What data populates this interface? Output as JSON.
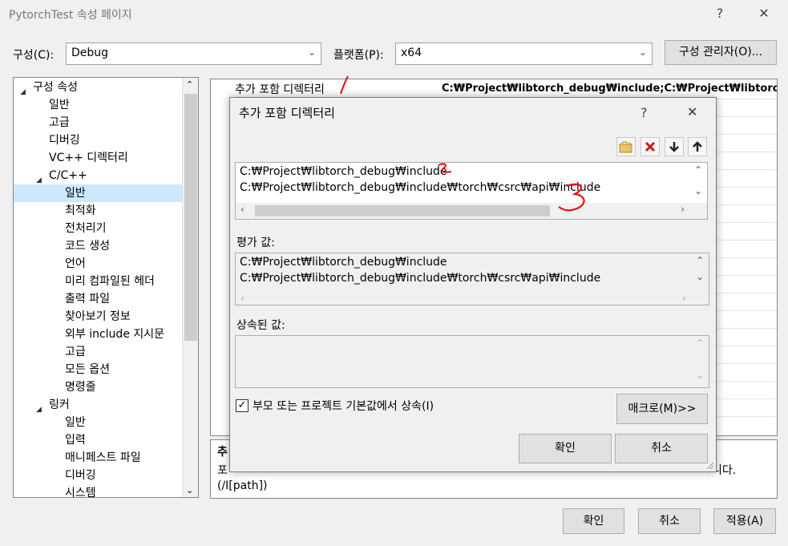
{
  "window": {
    "title": "PytorchTest 속성 페이지",
    "help": "?",
    "close": "✕"
  },
  "config": {
    "label": "구성(C):",
    "value": "Debug"
  },
  "platform": {
    "label": "플랫폼(P):",
    "value": "x64"
  },
  "config_manager_button": "구성 관리자(O)...",
  "tree": {
    "items": [
      {
        "label": "구성 속성",
        "level": 0,
        "expander": "◢"
      },
      {
        "label": "일반",
        "level": 1
      },
      {
        "label": "고급",
        "level": 1
      },
      {
        "label": "디버깅",
        "level": 1
      },
      {
        "label": "VC++ 디렉터리",
        "level": 1
      },
      {
        "label": "C/C++",
        "level": 1,
        "expander": "◢"
      },
      {
        "label": "일반",
        "level": 2,
        "selected": true
      },
      {
        "label": "최적화",
        "level": 2
      },
      {
        "label": "전처리기",
        "level": 2
      },
      {
        "label": "코드 생성",
        "level": 2
      },
      {
        "label": "언어",
        "level": 2
      },
      {
        "label": "미리 컴파일된 헤더",
        "level": 2
      },
      {
        "label": "출력 파일",
        "level": 2
      },
      {
        "label": "찾아보기 정보",
        "level": 2
      },
      {
        "label": "외부 include 지시문",
        "level": 2
      },
      {
        "label": "고급",
        "level": 2
      },
      {
        "label": "모든 옵션",
        "level": 2
      },
      {
        "label": "명령줄",
        "level": 2
      },
      {
        "label": "링커",
        "level": 1,
        "expander": "◢"
      },
      {
        "label": "일반",
        "level": 2
      },
      {
        "label": "입력",
        "level": 2
      },
      {
        "label": "매니페스트 파일",
        "level": 2
      },
      {
        "label": "디버깅",
        "level": 2
      },
      {
        "label": "시스템",
        "level": 2
      }
    ]
  },
  "property_grid": {
    "row_name": "추가 포함 디렉터리",
    "row_value": "C:₩Project₩libtorch_debug₩include;C:₩Project₩libtorch_del"
  },
  "description": {
    "title": "추",
    "text": "포함 경로에 추가할 하나 이상의 디렉터리를 지정합니다. 경로가 여러 개인 경우 세미콜론으로 구분합니다.",
    "visible_text": "포",
    "visible_tail": "니다.",
    "switch": "(/I[path])"
  },
  "dialog": {
    "title": "추가 포함 디렉터리",
    "help": "?",
    "close": "✕",
    "entries": [
      "C:₩Project₩libtorch_debug₩include",
      "C:₩Project₩libtorch_debug₩include₩torch₩csrc₩api₩include"
    ],
    "evaluated_label": "평가 값:",
    "evaluated": [
      "C:₩Project₩libtorch_debug₩include",
      "C:₩Project₩libtorch_debug₩include₩torch₩csrc₩api₩include"
    ],
    "inherited_label": "상속된 값:",
    "inherit_checkbox": "부모 또는 프로젝트 기본값에서 상속(I)",
    "inherit_checked": true,
    "macro_button": "매크로(M)>>",
    "ok": "확인",
    "cancel": "취소"
  },
  "footer": {
    "ok": "확인",
    "cancel": "취소",
    "apply": "적용(A)"
  },
  "colors": {
    "selection": "#cce8ff",
    "annotation": "#e81010",
    "window_bg": "#f0f0f0"
  }
}
